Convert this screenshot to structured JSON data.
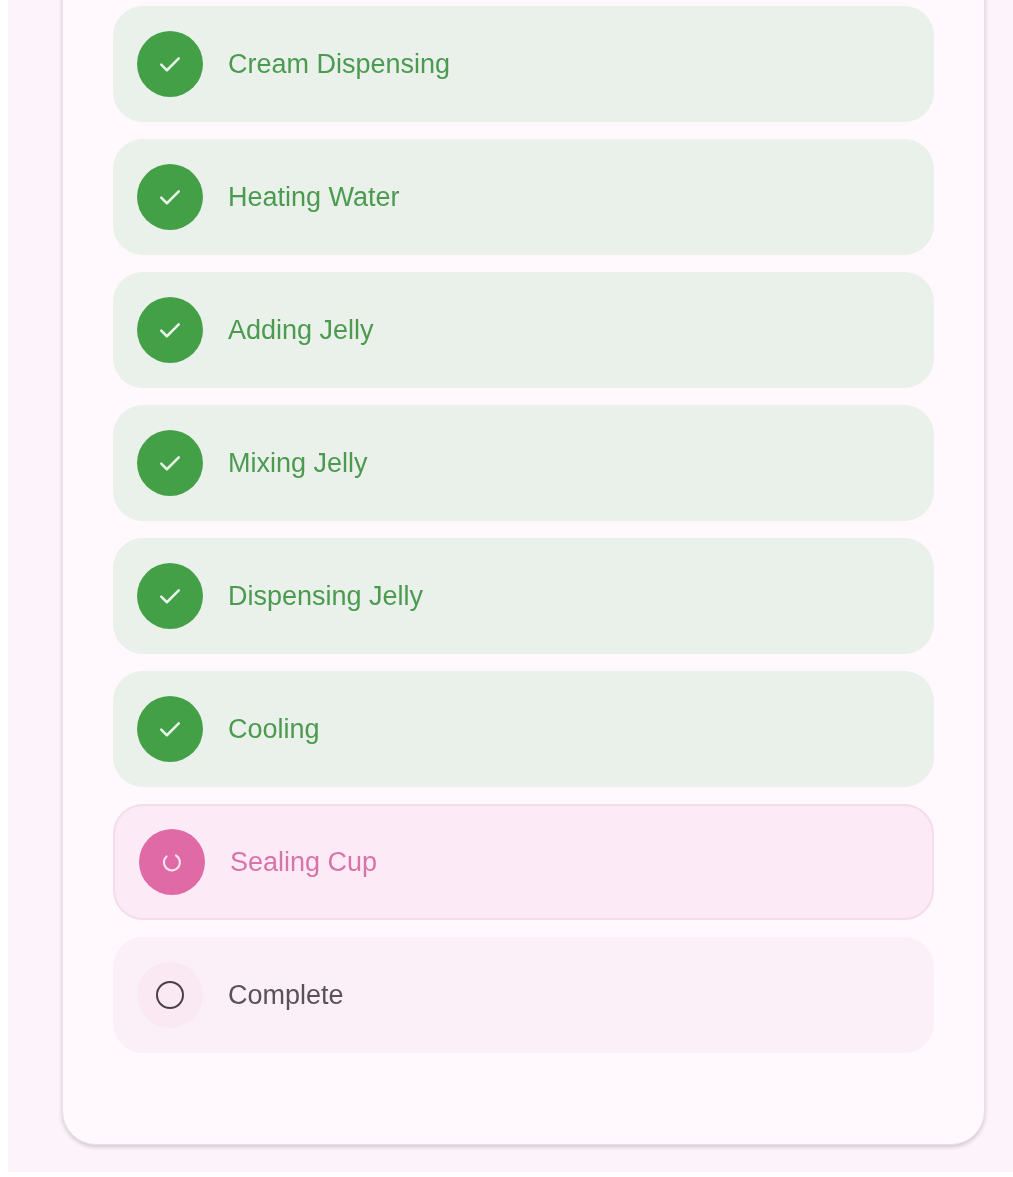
{
  "steps": [
    {
      "label": "Cream Dispensing",
      "kind": "done"
    },
    {
      "label": "Heating Water",
      "kind": "done"
    },
    {
      "label": "Adding Jelly",
      "kind": "done"
    },
    {
      "label": "Mixing Jelly",
      "kind": "done"
    },
    {
      "label": "Dispensing Jelly",
      "kind": "done"
    },
    {
      "label": "Cooling",
      "kind": "done"
    },
    {
      "label": "Sealing Cup",
      "kind": "active"
    },
    {
      "label": "Complete",
      "kind": "pending"
    }
  ]
}
